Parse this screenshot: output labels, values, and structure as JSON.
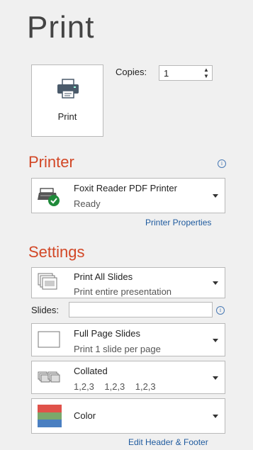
{
  "page_title": "Print",
  "print_button": {
    "label": "Print",
    "icon": "printer-icon"
  },
  "copies": {
    "label": "Copies:",
    "value": "1"
  },
  "printer": {
    "section_title": "Printer",
    "name": "Foxit Reader PDF Printer",
    "status": "Ready",
    "icon": "printer-ready-icon",
    "properties_link": "Printer Properties"
  },
  "settings": {
    "section_title": "Settings",
    "slide_range": {
      "main": "Print All Slides",
      "sub": "Print entire presentation",
      "icon": "slides-stack-icon"
    },
    "slides": {
      "label": "Slides:",
      "value": ""
    },
    "layout": {
      "main": "Full Page Slides",
      "sub": "Print 1 slide per page",
      "icon": "full-page-slide-icon"
    },
    "collation": {
      "main": "Collated",
      "sub": "1,2,3    1,2,3    1,2,3",
      "icon": "collated-icon"
    },
    "color": {
      "main": "Color",
      "icon": "color-swatch-icon",
      "swatch_colors": [
        "#e0524a",
        "#7aa86b",
        "#4a7fc1"
      ]
    },
    "header_footer_link": "Edit Header & Footer"
  }
}
